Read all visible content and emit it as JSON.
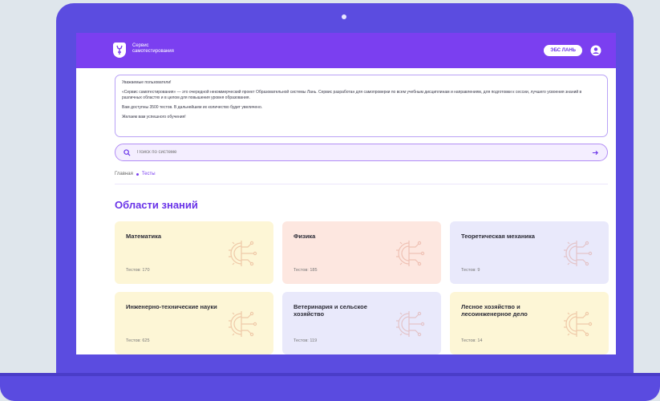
{
  "header": {
    "brand_line1": "Сервис",
    "brand_line2": "самотестирования",
    "ebs_button": "ЭБС ЛАНЬ"
  },
  "notice": {
    "greeting": "Уважаемые пользователи!",
    "para1": "«Сервис самотестирования» — это очередной некоммерческий проект Образовательной системы Лань. Сервис разработан для самопроверки по всем учебным дисциплинам и направлениям, для подготовки к сессии, лучшего усвоения знаний в различных областях и в целом для повышения уровня образования.",
    "para2": "Вам доступны 3500 тестов. В дальнейшем их количество будет увеличено.",
    "para3": "Желаем вам успешного обучения!"
  },
  "search": {
    "placeholder": "Поиск по системе"
  },
  "breadcrumb": {
    "home": "Главная",
    "current": "Тесты"
  },
  "page_title": "Области знаний",
  "cards": [
    {
      "title": "Математика",
      "count": "Тестов: 170",
      "color": "#fdf6d6"
    },
    {
      "title": "Физика",
      "count": "Тестов: 185",
      "color": "#fde7e0"
    },
    {
      "title": "Теоретическая механика",
      "count": "Тестов: 9",
      "color": "#e9e9fb"
    },
    {
      "title": "Инженерно-технические науки",
      "count": "Тестов: 625",
      "color": "#fdf6d6"
    },
    {
      "title": "Ветеринария и сельское хозяйство",
      "count": "Тестов: 119",
      "color": "#e9e9fb"
    },
    {
      "title": "Лесное хозяйство и лесоинженерное дело",
      "count": "Тестов: 14",
      "color": "#fdf6d6"
    }
  ],
  "colors": {
    "accent": "#7b3ff0",
    "frame": "#5b4ce0"
  }
}
